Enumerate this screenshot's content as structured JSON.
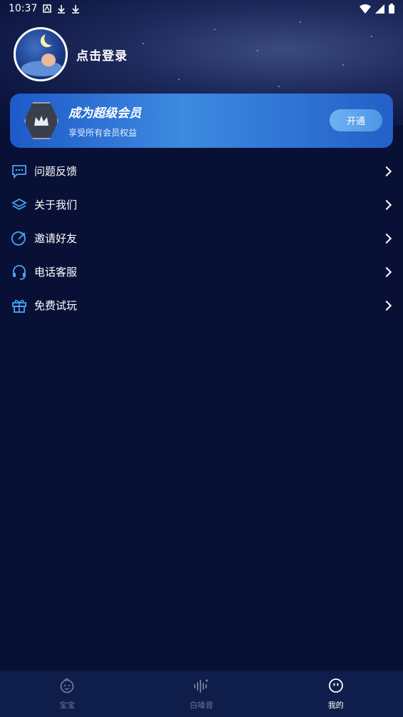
{
  "status_bar": {
    "time": "10:37"
  },
  "profile": {
    "login_text": "点击登录"
  },
  "vip": {
    "title": "成为超级会员",
    "subtitle": "享受所有会员权益",
    "button_label": "开通"
  },
  "menu": [
    {
      "label": "问题反馈",
      "icon": "feedback-icon"
    },
    {
      "label": "关于我们",
      "icon": "layers-icon"
    },
    {
      "label": "邀请好友",
      "icon": "invite-icon"
    },
    {
      "label": "电话客服",
      "icon": "headset-icon"
    },
    {
      "label": "免费试玩",
      "icon": "gift-icon"
    }
  ],
  "tabbar": [
    {
      "label": "宝宝",
      "icon": "baby-icon",
      "active": false
    },
    {
      "label": "白噪音",
      "icon": "sound-wave-icon",
      "active": false
    },
    {
      "label": "我的",
      "icon": "smile-icon",
      "active": true
    }
  ],
  "colors": {
    "background": "#081135",
    "accent": "#4e96e6",
    "icon_blue": "#4aa3f5"
  }
}
